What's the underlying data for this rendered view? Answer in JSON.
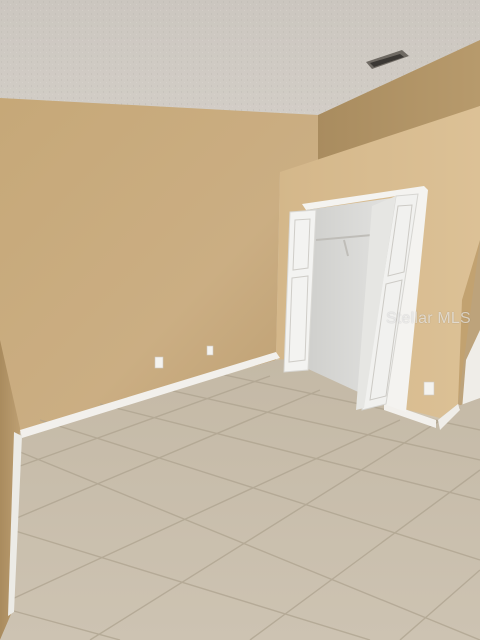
{
  "photo": {
    "watermark_text": "Stellar MLS",
    "colors": {
      "ceiling": "#cdc8c1",
      "back_wall": "#c8a97c",
      "right_wall": "#d6b98c",
      "floor_tile": "#c9bfae",
      "grout": "#b3a894",
      "trim": "#f2f0ec",
      "door": "#f3f3f1",
      "closet_interior": "#d9d9d7"
    }
  }
}
